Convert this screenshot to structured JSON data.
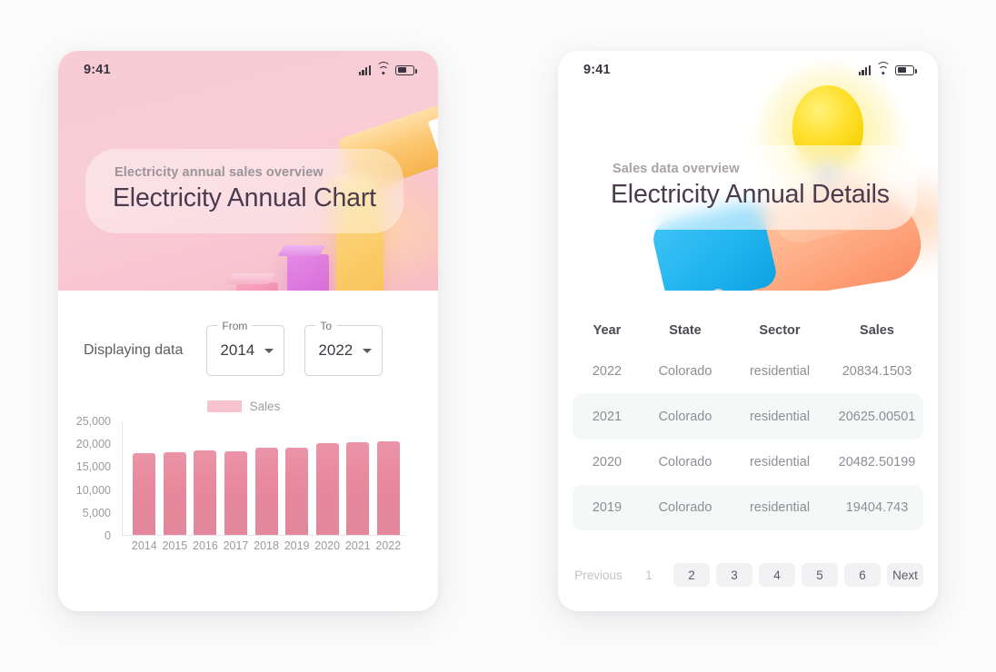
{
  "left_card": {
    "status": {
      "time": "9:41",
      "icons": [
        "signal-icon",
        "wifi-icon",
        "battery-icon"
      ]
    },
    "hero": {
      "eyebrow": "Electricity annual sales overview",
      "title": "Electricity Annual Chart"
    },
    "filters": {
      "label": "Displaying data",
      "from": {
        "label": "From",
        "value": "2014"
      },
      "to": {
        "label": "To",
        "value": "2022"
      }
    },
    "chart_data": {
      "type": "bar",
      "title": "",
      "xlabel": "",
      "ylabel": "",
      "legend": [
        "Sales"
      ],
      "legend_position": "top-center",
      "grid": false,
      "ylim": [
        0,
        25000
      ],
      "yticks": [
        "25,000",
        "20,000",
        "15,000",
        "10,000",
        "5,000",
        "0"
      ],
      "ytick_values": [
        25000,
        20000,
        15000,
        10000,
        5000,
        0
      ],
      "categories": [
        "2014",
        "2015",
        "2016",
        "2017",
        "2018",
        "2019",
        "2020",
        "2021",
        "2022"
      ],
      "series": [
        {
          "name": "Sales",
          "color": "#e8899d",
          "values": [
            17800,
            18050,
            18450,
            18250,
            19000,
            19050,
            20100,
            20250,
            20500
          ]
        }
      ]
    },
    "colors": {
      "bar": "#e8899d",
      "legend_swatch": "#f7c3cf",
      "hero_bg": "#f8c9d3"
    }
  },
  "right_card": {
    "status": {
      "time": "9:41",
      "icons": [
        "signal-icon",
        "wifi-icon",
        "battery-icon"
      ]
    },
    "hero": {
      "eyebrow": "Sales data overview",
      "title": "Electricity Annual Details"
    },
    "table": {
      "columns": [
        "Year",
        "State",
        "Sector",
        "Sales"
      ],
      "rows": [
        [
          "2022",
          "Colorado",
          "residential",
          "20834.1503"
        ],
        [
          "2021",
          "Colorado",
          "residential",
          "20625.00501"
        ],
        [
          "2020",
          "Colorado",
          "residential",
          "20482.50199"
        ],
        [
          "2019",
          "Colorado",
          "residential",
          "19404.743"
        ]
      ]
    },
    "pagination": {
      "previous": "Previous",
      "next": "Next",
      "pages": [
        "1",
        "2",
        "3",
        "4",
        "5",
        "6"
      ],
      "current": "1"
    }
  }
}
